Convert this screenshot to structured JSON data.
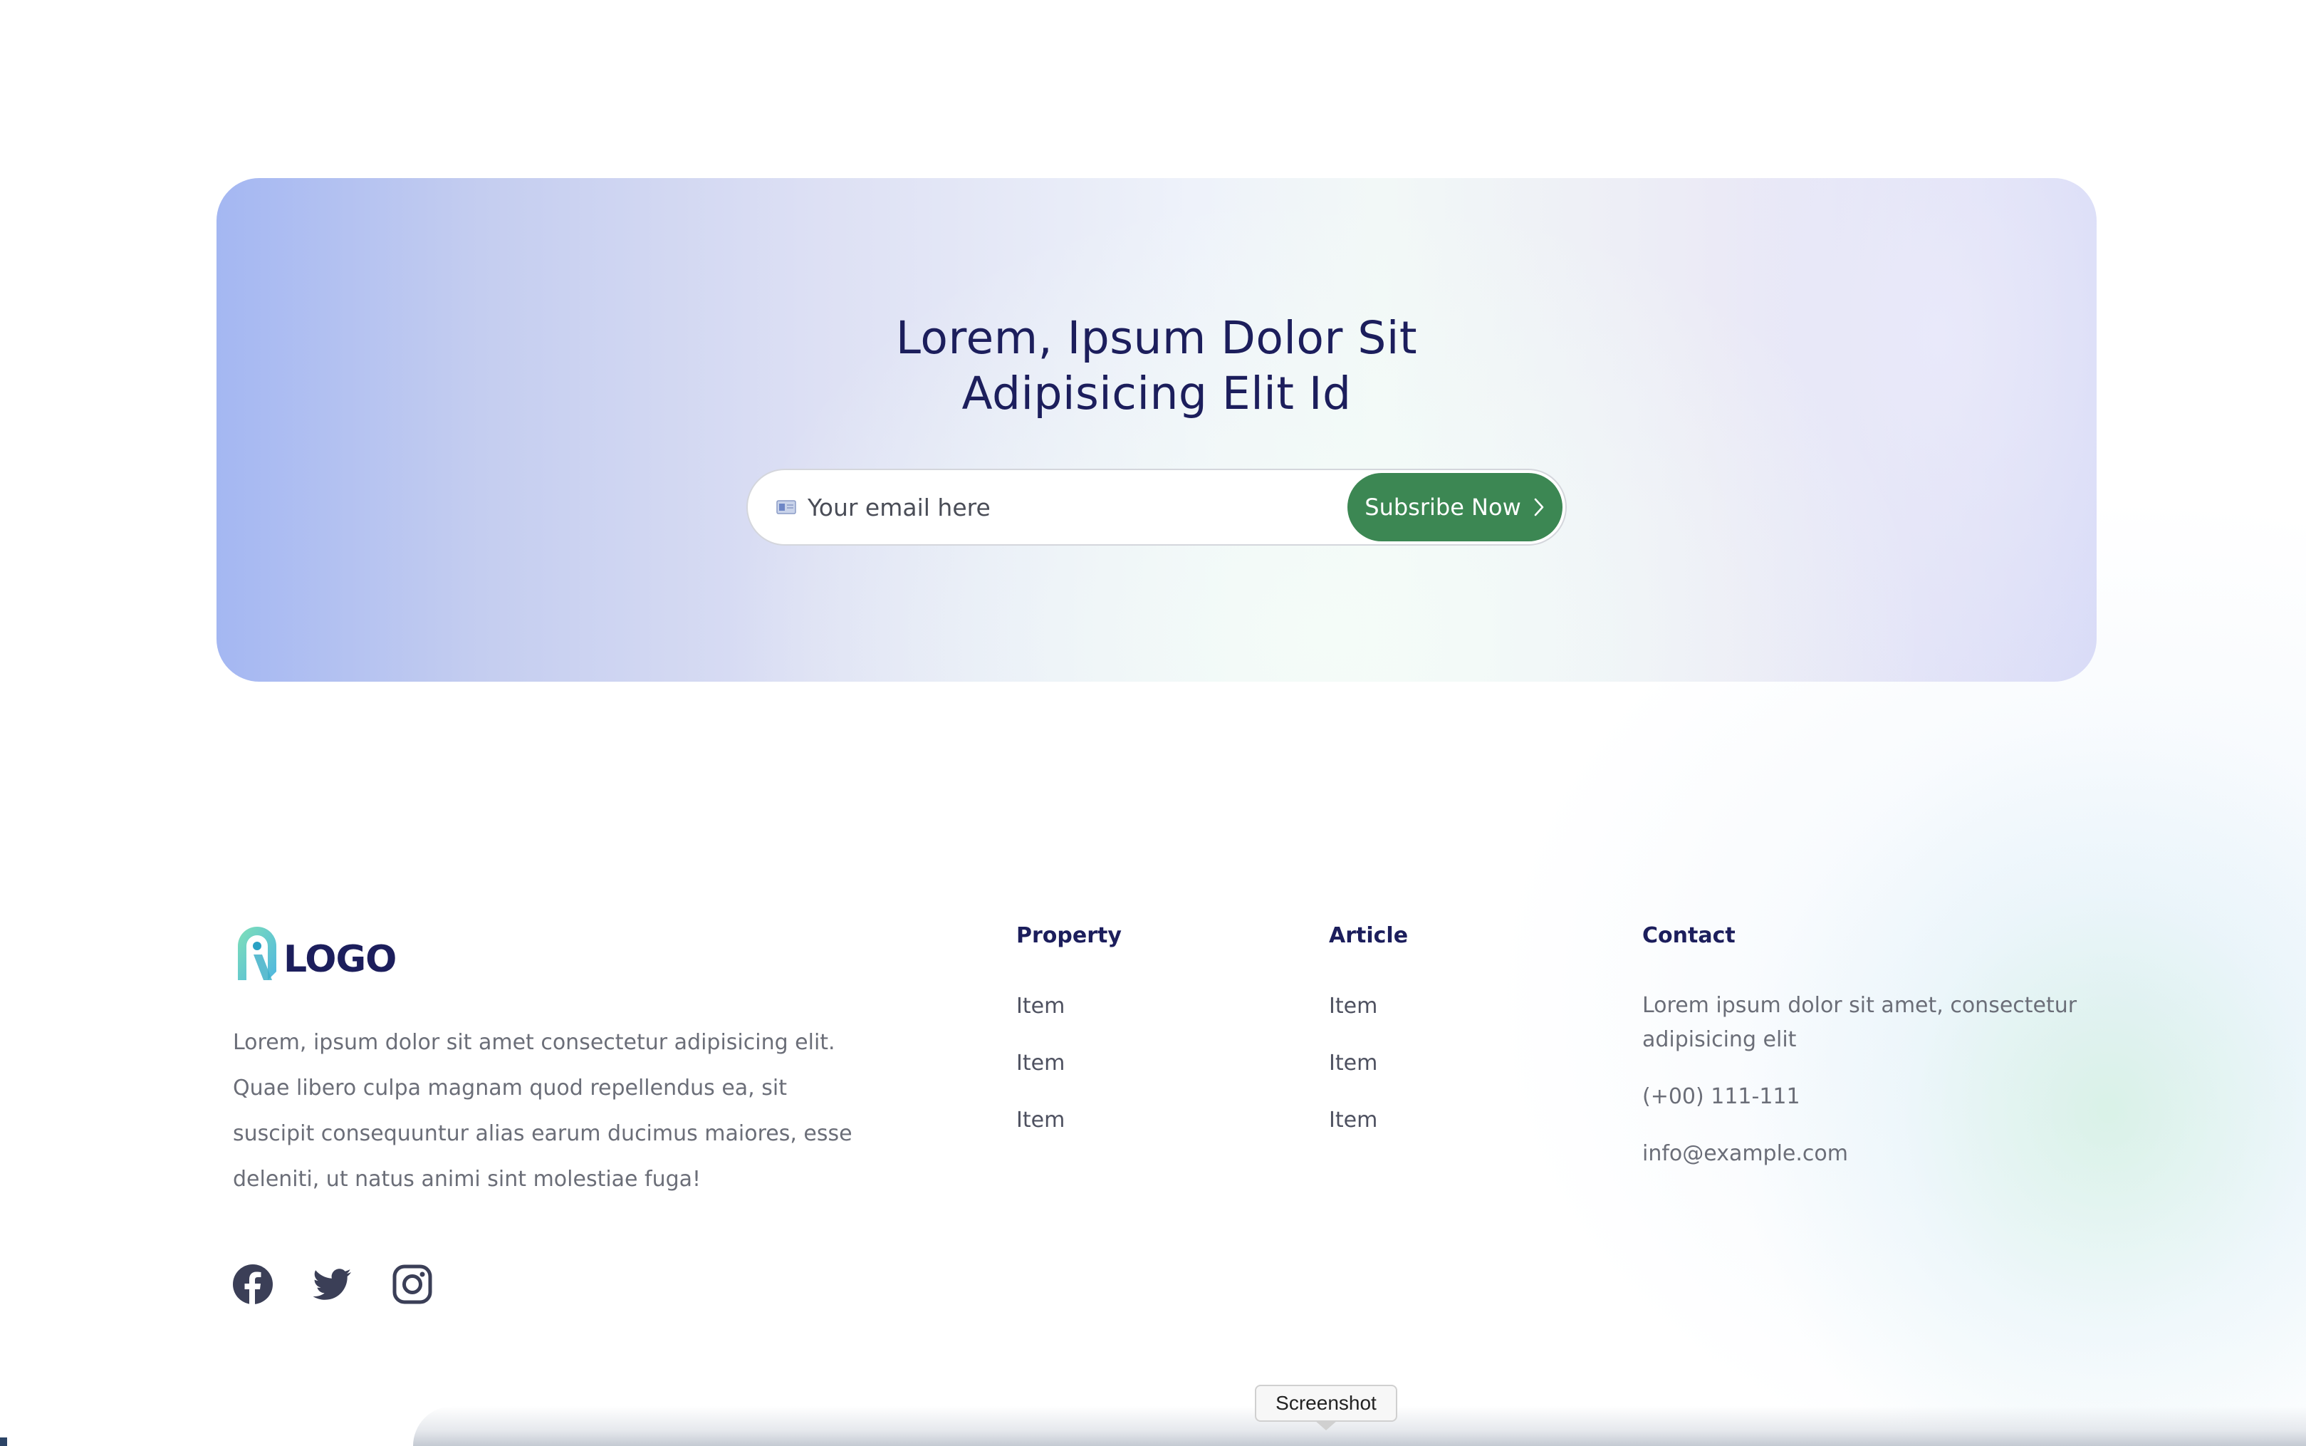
{
  "banner": {
    "title_line1": "Lorem, Ipsum Dolor Sit",
    "title_line2": "Adipisicing Elit Id",
    "email_placeholder": "Your email here",
    "button_label": "Subsribe Now"
  },
  "footer": {
    "logo_text": "LOGO",
    "about": "Lorem, ipsum dolor sit amet consectetur adipisicing elit. Quae libero culpa magnam quod repellendus ea, sit suscipit consequuntur alias earum ducimus maiores, esse deleniti, ut natus animi sint molestiae fuga!",
    "social": [
      "facebook-icon",
      "twitter-icon",
      "instagram-icon"
    ],
    "columns": [
      {
        "title": "Property",
        "items": [
          "Item",
          "Item",
          "Item"
        ]
      },
      {
        "title": "Article",
        "items": [
          "Item",
          "Item",
          "Item"
        ]
      }
    ],
    "contact": {
      "title": "Contact",
      "address": "Lorem ipsum dolor sit amet, consectetur adipisicing elit",
      "phone": "(+00) 111-111",
      "email": "info@example.com"
    }
  },
  "tooltip": {
    "label": "Screenshot"
  },
  "colors": {
    "primary_text": "#1c1e5c",
    "button_green": "#3c8753",
    "body_text": "#6b6e78"
  }
}
